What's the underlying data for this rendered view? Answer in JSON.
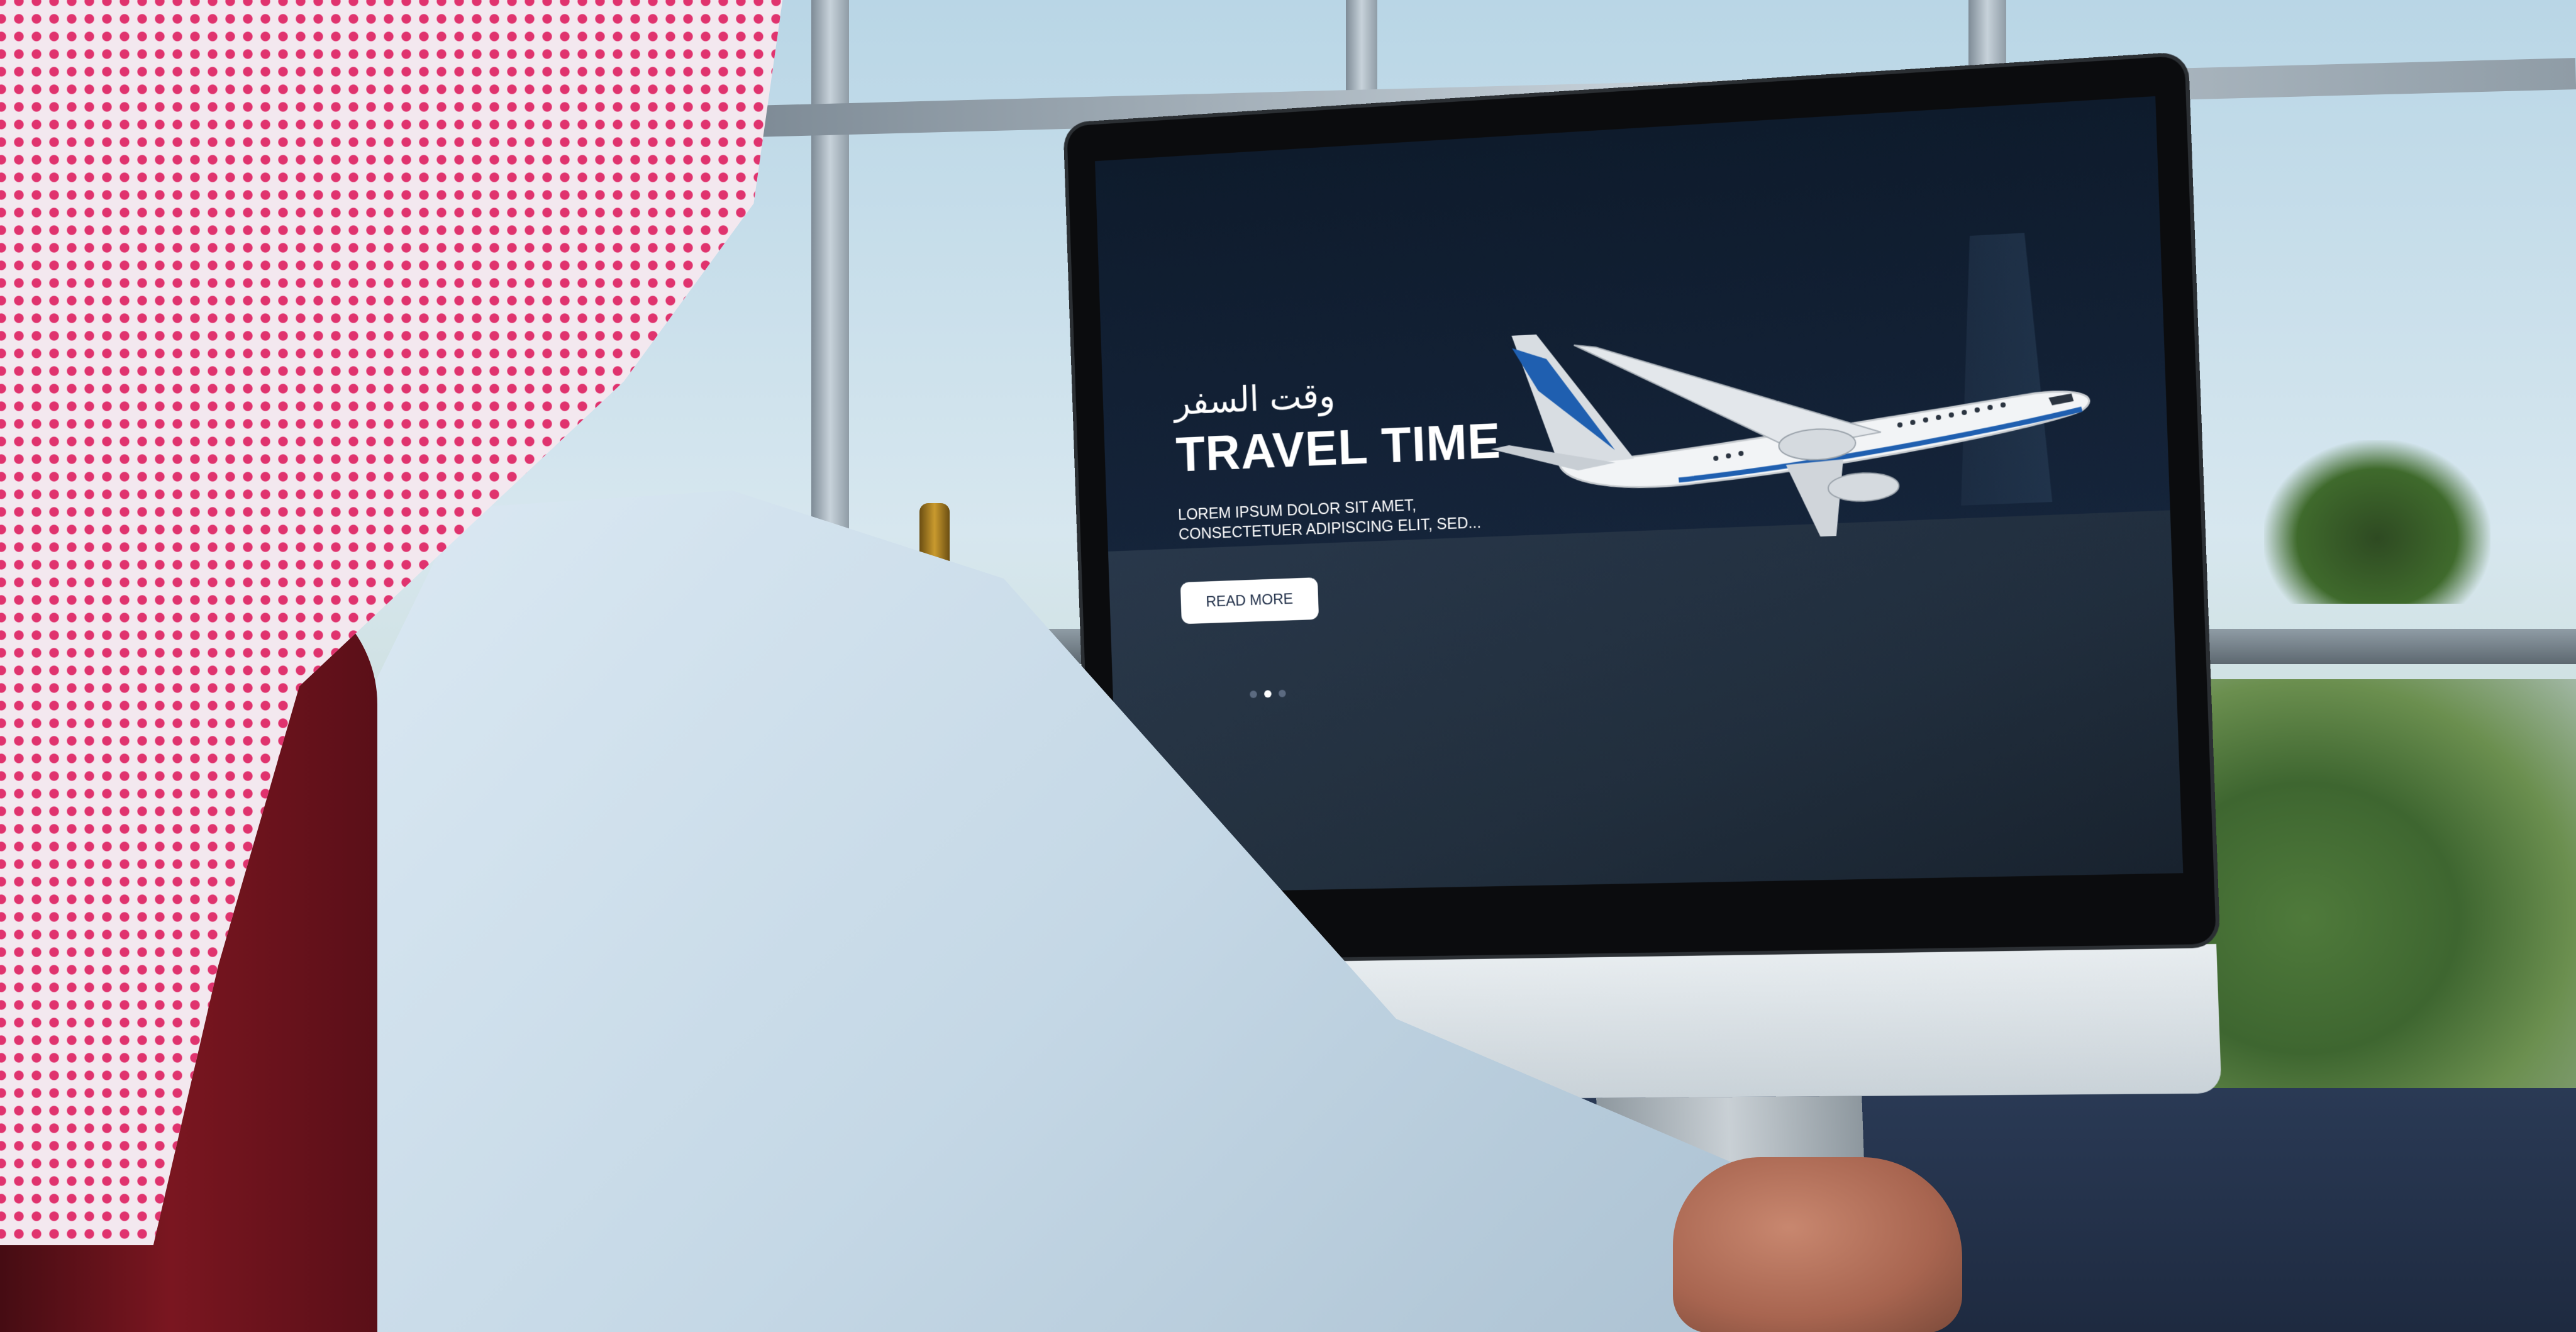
{
  "hero": {
    "arabic_title": "وقت السفر",
    "title": "TRAVEL TIME",
    "subtitle_line1": "LOREM IPSUM DOLOR SIT AMET,",
    "subtitle_line2": "CONSECTETUER ADIPISCING ELIT, SED...",
    "button_label": "READ MORE"
  },
  "carousel": {
    "slide_count": 3,
    "active_slide": 2
  },
  "colors": {
    "screen_bg": "#0e1b2c",
    "button_bg": "#ffffff",
    "button_text": "#1b2a44",
    "ghutra_red": "#e0336e",
    "airplane_tail": "#1f5fb0"
  },
  "icons": [
    "airplane-icon"
  ]
}
